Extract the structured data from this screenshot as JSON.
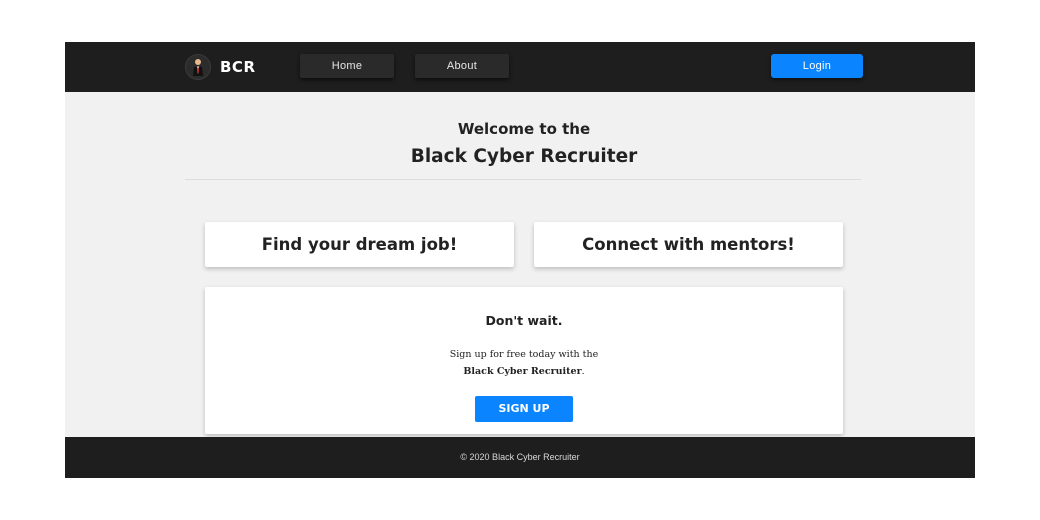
{
  "navbar": {
    "brand_icon": "person-in-suit-logo-icon",
    "brand_text": "BCR",
    "links": [
      {
        "label": "Home"
      },
      {
        "label": "About"
      }
    ],
    "login_label": "Login"
  },
  "hero": {
    "welcome": "Welcome to the",
    "title": "Black Cyber Recruiter"
  },
  "cards": [
    {
      "title": "Find your dream job!"
    },
    {
      "title": "Connect with mentors!"
    }
  ],
  "signup": {
    "heading": "Don't wait.",
    "line1": "Sign up for free today with the",
    "line2_strong": "Black Cyber Recruiter",
    "line2_end": ".",
    "button_label": "SIGN UP"
  },
  "footer": {
    "text": "© 2020 Black Cyber Recruiter"
  },
  "colors": {
    "nav_background": "#1e1e1e",
    "page_background": "#f1f1f1",
    "accent_blue": "#0a84ff",
    "text_dark": "#222222"
  }
}
